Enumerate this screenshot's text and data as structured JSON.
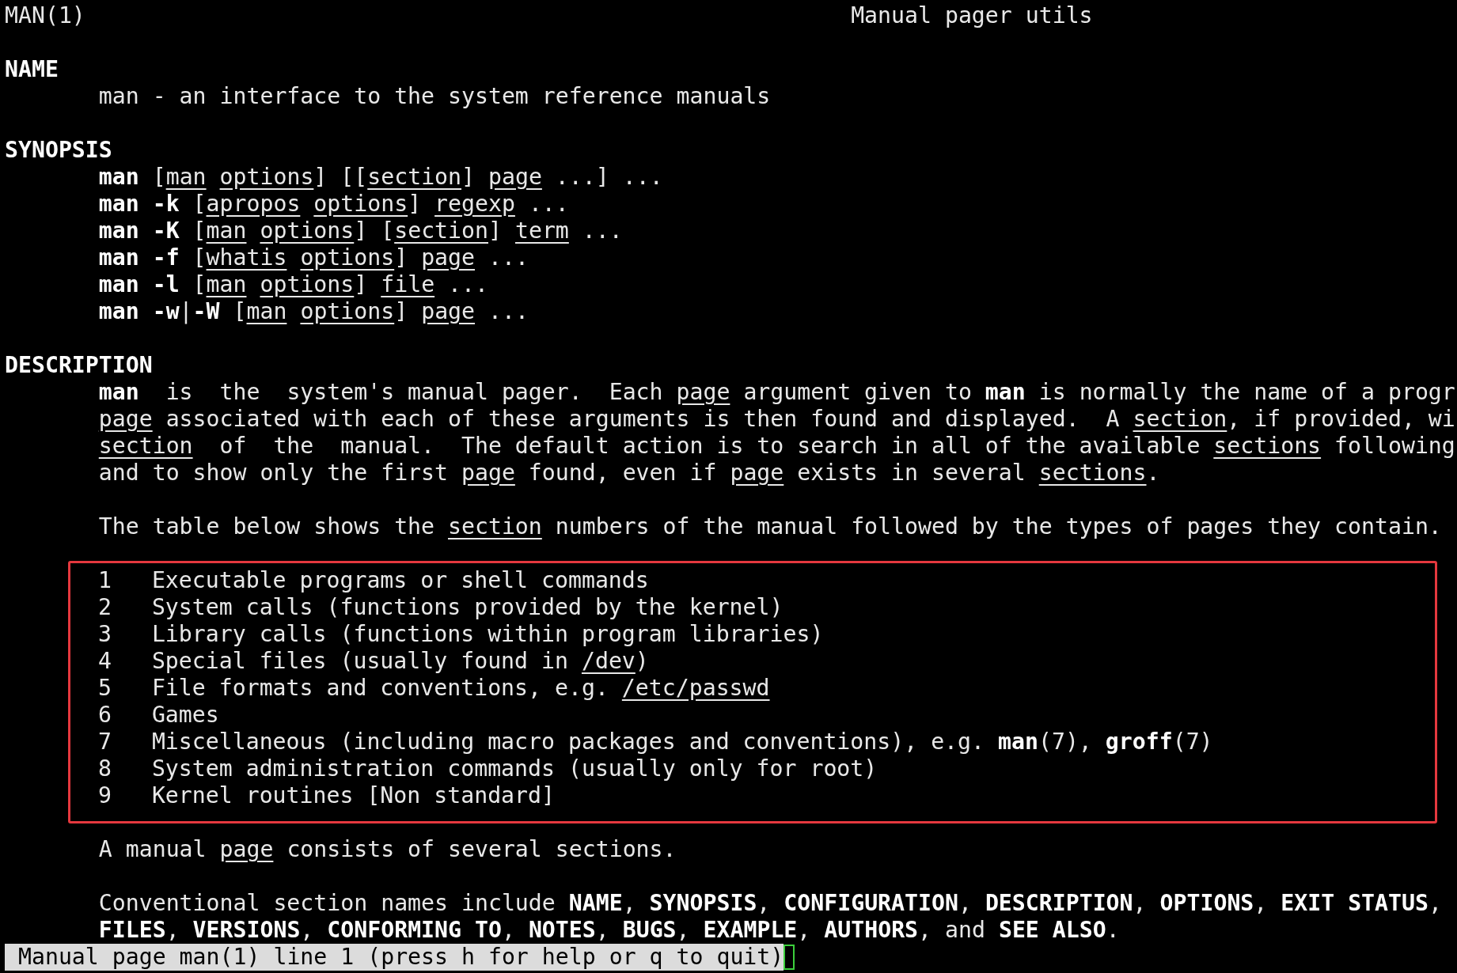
{
  "header": {
    "left": "MAN(1)",
    "center": "Manual pager utils"
  },
  "blocks": [
    {
      "kind": "text",
      "lines": [
        {
          "kind": "heading",
          "text": "NAME"
        },
        {
          "kind": "body",
          "text": "man - an interface to the system reference manuals"
        }
      ]
    },
    {
      "kind": "text",
      "lines": [
        {
          "kind": "heading",
          "text": "SYNOPSIS"
        },
        {
          "kind": "body",
          "text": "**man** [*man* *options*] [[*section*] *page* ...] ..."
        },
        {
          "kind": "body",
          "text": "**man -k** [*apropos* *options*] *regexp* ..."
        },
        {
          "kind": "body",
          "text": "**man -K** [*man* *options*] [*section*] *term* ..."
        },
        {
          "kind": "body",
          "text": "**man -f** [*whatis* *options*] *page* ..."
        },
        {
          "kind": "body",
          "text": "**man -l** [*man* *options*] *file* ..."
        },
        {
          "kind": "body",
          "text": "**man -w**|**-W** [*man* *options*] *page* ..."
        }
      ]
    },
    {
      "kind": "text",
      "lines": [
        {
          "kind": "heading",
          "text": "DESCRIPTION"
        },
        {
          "kind": "body",
          "text": "**man**  is  the  system's manual pager.  Each *page* argument given to **man** is normally the name of a progr"
        },
        {
          "kind": "body",
          "text": "*page* associated with each of these arguments is then found and displayed.  A *section*, if provided, wi"
        },
        {
          "kind": "body",
          "text": "*section*  of  the  manual.  The default action is to search in all of the available *sections* following"
        },
        {
          "kind": "body",
          "text": "and to show only the first *page* found, even if *page* exists in several *sections*."
        }
      ]
    },
    {
      "kind": "text",
      "lines": [
        {
          "kind": "body",
          "text": "The table below shows the *section* numbers of the manual followed by the types of pages they contain."
        }
      ]
    },
    {
      "kind": "table",
      "rows": [
        {
          "number": "1",
          "text": "Executable programs or shell commands"
        },
        {
          "number": "2",
          "text": "System calls (functions provided by the kernel)"
        },
        {
          "number": "3",
          "text": "Library calls (functions within program libraries)"
        },
        {
          "number": "4",
          "text": "Special files (usually found in */dev*)"
        },
        {
          "number": "5",
          "text": "File formats and conventions, e.g. */etc/passwd*"
        },
        {
          "number": "6",
          "text": "Games"
        },
        {
          "number": "7",
          "text": "Miscellaneous (including macro packages and conventions), e.g. **man**(7), **groff**(7)"
        },
        {
          "number": "8",
          "text": "System administration commands (usually only for root)"
        },
        {
          "number": "9",
          "text": "Kernel routines [Non standard]"
        }
      ]
    },
    {
      "kind": "text",
      "lines": [
        {
          "kind": "body",
          "text": "A manual *page* consists of several sections."
        }
      ]
    },
    {
      "kind": "text",
      "lines": [
        {
          "kind": "body",
          "text": "Conventional section names include **NAME**, **SYNOPSIS**, **CONFIGURATION**, **DESCRIPTION**, **OPTIONS**, **EXIT STATUS**,"
        },
        {
          "kind": "body",
          "text": "**FILES**, **VERSIONS**, **CONFORMING TO**, **NOTES**, **BUGS**, **EXAMPLE**, **AUTHORS**, and **SEE ALSO**."
        }
      ]
    }
  ],
  "status_bar": {
    "text": " Manual page man(1) line 1 (press h for help or q to quit)"
  }
}
